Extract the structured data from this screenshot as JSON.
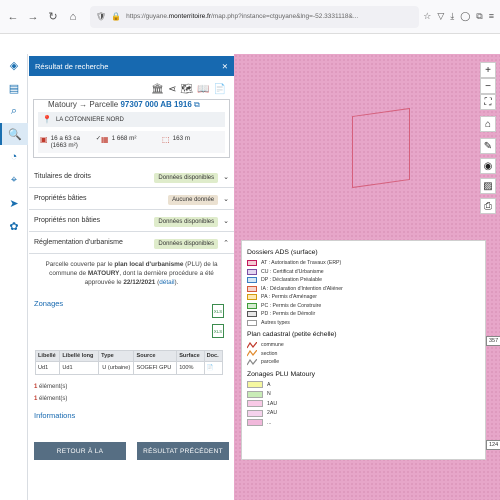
{
  "browser": {
    "url_prefix": "https://guyane.",
    "url_domain": "monterritoire.fr",
    "url_rest": "/map.php?instance=ctguyane&lng=-52.3331118&..."
  },
  "panel": {
    "title": "Résultat de recherche",
    "close": "✕",
    "parcel_prefix": "Matoury → Parcelle",
    "parcel_id": "97307 000 AB 1916",
    "address": "LA COTONNIERE NORD",
    "stats": [
      {
        "icon": "area-icon",
        "text": "16 a 63 ca (1663 m²)",
        "check": "✓"
      },
      {
        "icon": "building-icon",
        "text": "1 668 m²"
      },
      {
        "icon": "perimeter-icon",
        "text": "163 m"
      }
    ],
    "accordions": [
      {
        "label": "Titulaires de droits",
        "badge": "Données disponibles",
        "color": "green",
        "chev": "⌄"
      },
      {
        "label": "Propriétés bâties",
        "badge": "Aucune donnée",
        "color": "tan",
        "chev": "⌄"
      },
      {
        "label": "Propriétés non bâties",
        "badge": "Données disponibles",
        "color": "green",
        "chev": "⌄"
      },
      {
        "label": "Réglementation d'urbanisme",
        "badge": "Données disponibles",
        "color": "green",
        "chev": "⌃"
      }
    ],
    "urb": {
      "t1": "Parcelle couverte par le ",
      "t2": "plan local d'urbanisme",
      "t3": " (PLU) de la commune de ",
      "t4": "MATOURY",
      "t5": ", dont la dernière procédure a été approuvée le ",
      "t6": "22/12/2021",
      "t7": " (",
      "t8": "détail",
      "t9": ")."
    },
    "zonages_title": "Zonages",
    "xls": "XLS",
    "table": {
      "headers": [
        "Libellé",
        "Libellé long",
        "Type",
        "Source",
        "Surface",
        "Doc."
      ],
      "row": [
        "Ud1",
        "Ud1",
        "U (urbaine)",
        "SOGEFI GPU",
        "100%",
        "📄"
      ]
    },
    "count1_num": "1",
    "count1_text": " élément(s)",
    "count2_num": "1",
    "count2_text": " élément(s)",
    "informations": "Informations",
    "btn_back": "RETOUR À LA",
    "btn_prev": "RÉSULTAT PRÉCÉDENT"
  },
  "map": {
    "scale1": "357",
    "scale2": "124",
    "legend": {
      "ads_title": "Dossiers ADS (surface)",
      "ads_items": [
        {
          "label": "AT : Autorisation de Travaux (ERP)",
          "color": "#f4c9d3",
          "border": "#c2185b"
        },
        {
          "label": "CU : Certificat d'Urbanisme",
          "color": "#e3d6f0",
          "border": "#7b4fa3"
        },
        {
          "label": "DP : Déclaration Préalable",
          "color": "#d7e8f5",
          "border": "#3b7ec2"
        },
        {
          "label": "IA : Déclaration d'Intention d'Aliéner",
          "color": "#f7d7cf",
          "border": "#d35b3a"
        },
        {
          "label": "PA : Permis d'Aménager",
          "color": "#fde9b5",
          "border": "#d49b0f"
        },
        {
          "label": "PC : Permis de Construire",
          "color": "#d5ecd0",
          "border": "#3e9b3a"
        },
        {
          "label": "PD : Permis de Démolir",
          "color": "#e7e7e7",
          "border": "#555"
        },
        {
          "label": "Autres types",
          "color": "#ffffff",
          "border": "#999"
        }
      ],
      "cad_title": "Plan cadastral (petite échelle)",
      "cad_items": [
        {
          "label": "commune",
          "color": "#c0392b"
        },
        {
          "label": "section",
          "color": "#e08a2d"
        },
        {
          "label": "parcelle",
          "color": "#888888"
        }
      ],
      "plu_title": "Zonages PLU Matoury",
      "plu_items": [
        {
          "label": "A",
          "color": "#f5f7a0"
        },
        {
          "label": "N",
          "color": "#c9ecb7"
        },
        {
          "label": "1AU",
          "color": "#f8c9e6"
        },
        {
          "label": "2AU",
          "color": "#f5d2ec"
        },
        {
          "label": "...",
          "color": "#f1b8db"
        }
      ]
    }
  }
}
